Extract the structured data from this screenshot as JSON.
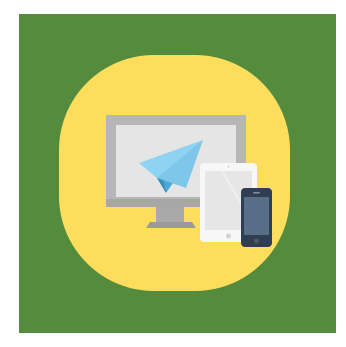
{
  "illustration": {
    "subject": "multi-device-messaging",
    "icons": [
      "desktop-monitor-icon",
      "paper-plane-icon",
      "tablet-icon",
      "smartphone-icon"
    ]
  },
  "colors": {
    "page_background": "#ffffff",
    "panel_green": "#558b3d",
    "badge_yellow": "#fdde5c",
    "monitor_frame": "#b6b6b6",
    "monitor_screen": "#e5e5e5",
    "monitor_stand": "#a9a9a9",
    "plane_light": "#8fd3f2",
    "plane_dark": "#4aa9d6",
    "tablet_body": "#f7f7f7",
    "tablet_screen": "#e6e6e6",
    "phone_body": "#2f3e52",
    "phone_screen": "#566e86"
  }
}
